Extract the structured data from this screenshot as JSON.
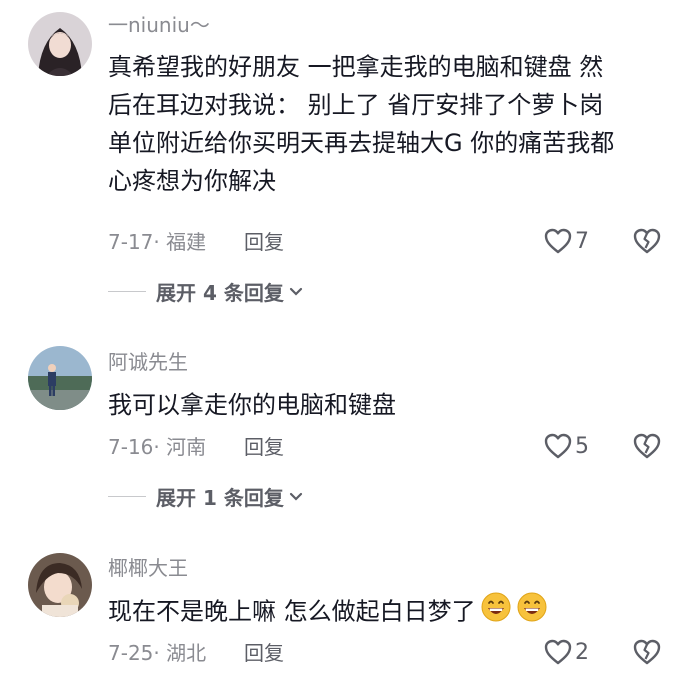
{
  "comments": [
    {
      "username": "一niuniu～",
      "lines": [
        "真希望我的好朋友 一把拿走我的电脑和键盘 然",
        "后在耳边对我说： 别上了 省厅安排了个萝卜岗",
        "单位附近给你买明天再去提轴大G 你的痛苦我都",
        "心疼想为你解决"
      ],
      "meta": "7-17· 福建",
      "reply_label": "回复",
      "likes": "7",
      "expand_label": "展开 4 条回复",
      "avatar": "avatar-girl"
    },
    {
      "username": "阿诚先生",
      "lines": [
        "我可以拿走你的电脑和键盘"
      ],
      "meta": "7-16· 河南",
      "reply_label": "回复",
      "likes": "5",
      "expand_label": "展开 1 条回复",
      "avatar": "avatar-landscape"
    },
    {
      "username": "椰椰大王",
      "lines": [
        "现在不是晚上嘛 怎么做起白日梦了"
      ],
      "emoji_count": 2,
      "meta": "7-25· 湖北",
      "reply_label": "回复",
      "likes": "2",
      "avatar": "avatar-girl-2"
    }
  ],
  "icons": {
    "like": "heart-outline-icon",
    "dislike": "broken-heart-icon",
    "expand": "chevron-down-icon",
    "emoji": "grinning-face-icon"
  },
  "colors": {
    "text": "#161823",
    "muted": "#8a8b91",
    "secondary": "#5c5e66",
    "emoji": "#f7c23c"
  }
}
